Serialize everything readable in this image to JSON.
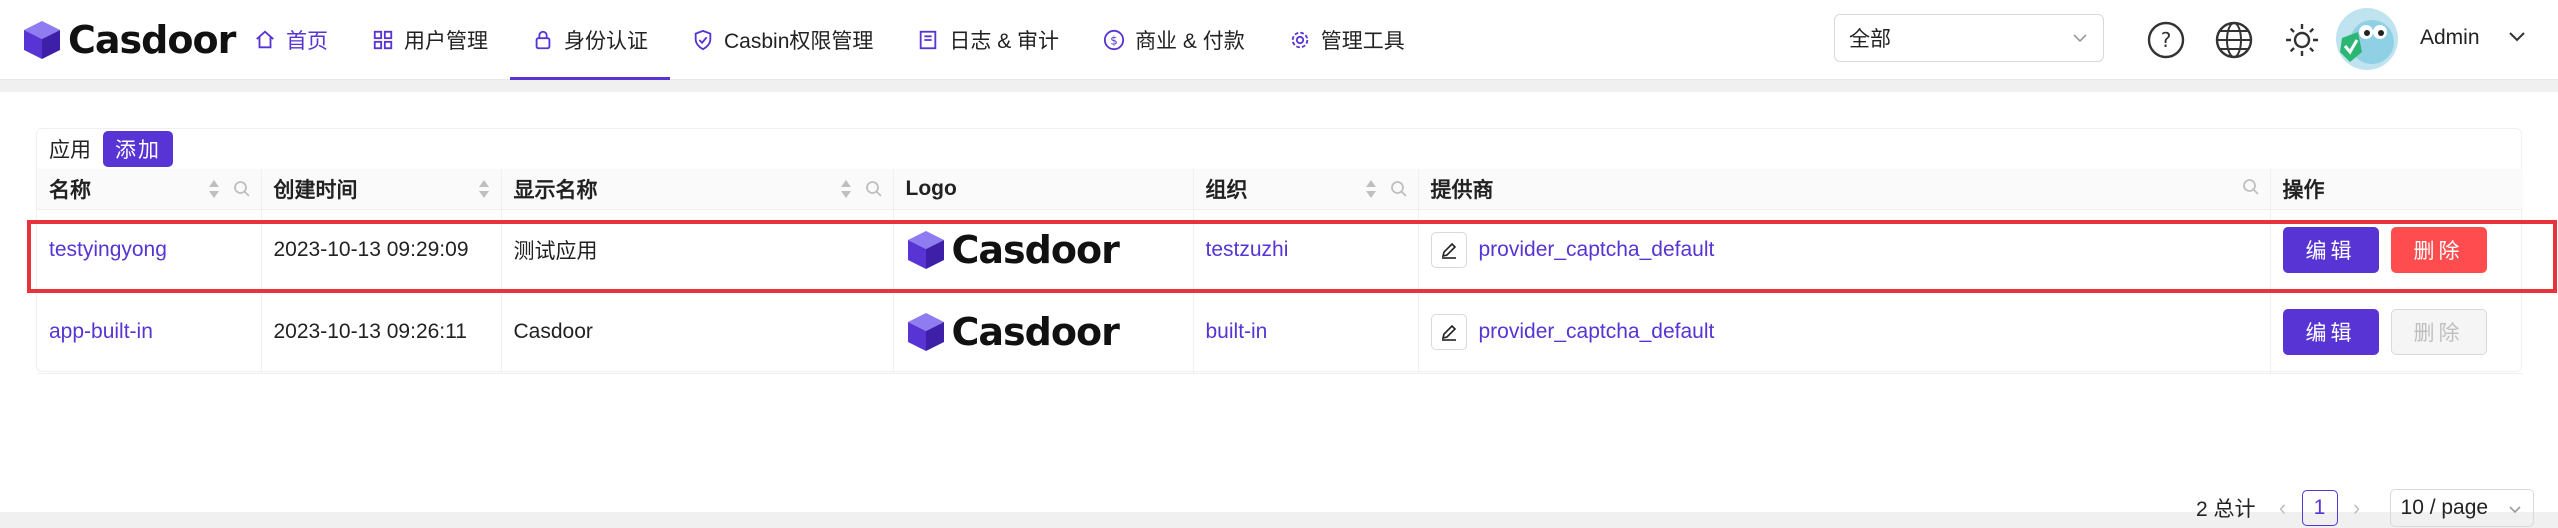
{
  "header": {
    "brand": "Casdoor",
    "nav": [
      {
        "label": "首页",
        "icon": "home-icon"
      },
      {
        "label": "用户管理",
        "icon": "grid-icon"
      },
      {
        "label": "身份认证",
        "icon": "lock-icon"
      },
      {
        "label": "Casbin权限管理",
        "icon": "shield-icon"
      },
      {
        "label": "日志 & 审计",
        "icon": "log-icon"
      },
      {
        "label": "商业 & 付款",
        "icon": "dollar-icon"
      },
      {
        "label": "管理工具",
        "icon": "gear-icon"
      }
    ],
    "org_select": "全部",
    "user": "Admin",
    "accent": "#5734d3"
  },
  "table": {
    "title": "应用",
    "add_label": "添加",
    "columns": [
      "名称",
      "创建时间",
      "显示名称",
      "Logo",
      "组织",
      "提供商",
      "操作"
    ],
    "rows": [
      {
        "name": "testyingyong",
        "created": "2023-10-13 09:29:09",
        "display": "测试应用",
        "logo": "Casdoor",
        "org": "testzuzhi",
        "provider": "provider_captcha_default",
        "edit": "编辑",
        "delete": "删除",
        "delete_enabled": true
      },
      {
        "name": "app-built-in",
        "created": "2023-10-13 09:26:11",
        "display": "Casdoor",
        "logo": "Casdoor",
        "org": "built-in",
        "provider": "provider_captcha_default",
        "edit": "编辑",
        "delete": "删除",
        "delete_enabled": false
      }
    ]
  },
  "pagination": {
    "total": "2 总计",
    "page": "1",
    "page_size": "10 / page"
  }
}
